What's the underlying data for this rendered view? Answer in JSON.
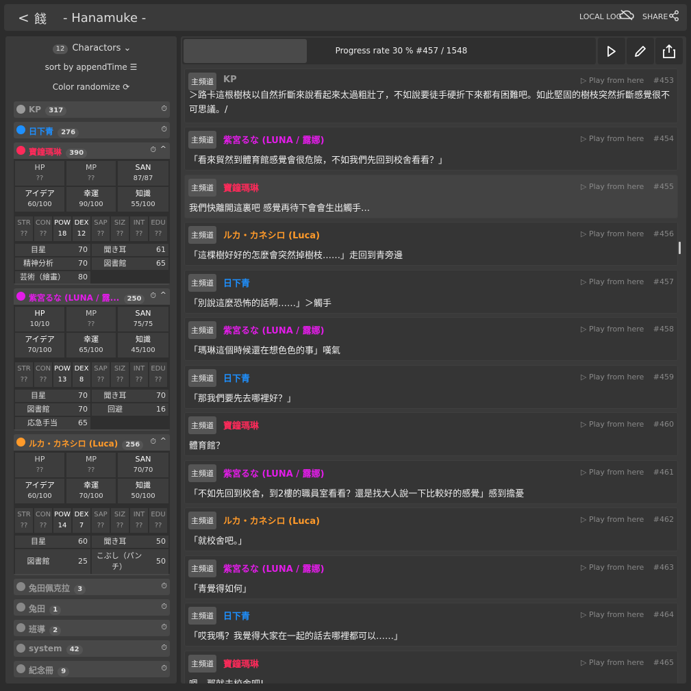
{
  "header": {
    "back_glyph": "<",
    "room_glyph": "餞",
    "title": "- Hanamuke -",
    "local_log": "LOCAL LOG",
    "share": "SHARE"
  },
  "sidebar": {
    "char_count": "12",
    "characters_label": "Charactors",
    "sort_label": "sort by appendTime",
    "color_label": "Color randomize",
    "characters": [
      {
        "name": "KP",
        "count": "317",
        "color": "#9a9a9a"
      },
      {
        "name": "日下青",
        "count": "276",
        "color": "#1e90ff"
      },
      {
        "name": "寶鐘瑪琳",
        "count": "390",
        "color": "#ff2a5a",
        "hp": "??",
        "mp": "??",
        "san": "87/87",
        "idea": "60/100",
        "luck": "90/100",
        "know": "55/100",
        "abilities": [
          [
            "STR",
            "??"
          ],
          [
            "CON",
            "??"
          ],
          [
            "POW",
            "18"
          ],
          [
            "DEX",
            "12"
          ],
          [
            "SAP",
            "??"
          ],
          [
            "SIZ",
            "??"
          ],
          [
            "INT",
            "??"
          ],
          [
            "EDU",
            "??"
          ]
        ],
        "skills": [
          [
            "目星",
            "70"
          ],
          [
            "聞き耳",
            "61"
          ],
          [
            "精神分析",
            "70"
          ],
          [
            "図書館",
            "65"
          ],
          [
            "芸術（繪畫）",
            "80"
          ]
        ]
      },
      {
        "name": "紫宮るな (LUNA / 露...",
        "count": "250",
        "color": "#e21ce8",
        "hp": "10/10",
        "mp": "??",
        "san": "75/75",
        "idea": "70/100",
        "luck": "65/100",
        "know": "45/100",
        "abilities": [
          [
            "STR",
            "??"
          ],
          [
            "CON",
            "??"
          ],
          [
            "POW",
            "13"
          ],
          [
            "DEX",
            "8"
          ],
          [
            "SAP",
            "??"
          ],
          [
            "SIZ",
            "??"
          ],
          [
            "INT",
            "??"
          ],
          [
            "EDU",
            "??"
          ]
        ],
        "skills": [
          [
            "目星",
            "70"
          ],
          [
            "聞き耳",
            "70"
          ],
          [
            "図書館",
            "70"
          ],
          [
            "回避",
            "16"
          ],
          [
            "応急手当",
            "65"
          ]
        ]
      },
      {
        "name": "ルカ・カネシロ (Luca)",
        "count": "256",
        "color": "#ff9a2a",
        "hp": "??",
        "mp": "??",
        "san": "70/70",
        "idea": "60/100",
        "luck": "70/100",
        "know": "50/100",
        "abilities": [
          [
            "STR",
            "??"
          ],
          [
            "CON",
            "??"
          ],
          [
            "POW",
            "14"
          ],
          [
            "DEX",
            "7"
          ],
          [
            "SAP",
            "??"
          ],
          [
            "SIZ",
            "??"
          ],
          [
            "INT",
            "??"
          ],
          [
            "EDU",
            "??"
          ]
        ],
        "skills": [
          [
            "目星",
            "60"
          ],
          [
            "聞き耳",
            "50"
          ],
          [
            "図書館",
            "25"
          ],
          [
            "こぶし（パンチ）",
            "50"
          ]
        ]
      },
      {
        "name": "兔田佩克拉",
        "count": "3",
        "color": "#9a9a9a"
      },
      {
        "name": "兔田",
        "count": "1",
        "color": "#9a9a9a"
      },
      {
        "name": "班導",
        "count": "2",
        "color": "#9a9a9a"
      },
      {
        "name": "system",
        "count": "42",
        "color": "#9a9a9a"
      },
      {
        "name": "紀念冊",
        "count": "9",
        "color": "#9a9a9a"
      }
    ],
    "stat_labels": {
      "hp": "HP",
      "mp": "MP",
      "san": "SAN",
      "idea": "アイデア",
      "luck": "幸運",
      "know": "知識"
    }
  },
  "toolbar": {
    "progress_text": "Progress rate 30 %  #457 / 1548",
    "progress_fraction": 0.3
  },
  "play_label": "Play from here",
  "messages": [
    {
      "channel": "主頻道",
      "who": "KP",
      "color": "#9a9a9a",
      "num": "#453",
      "text": "＞路卡這根樹枝以自然折斷來說看起來太過粗壯了，不如說要徒手硬折下來都有困難吧。如此堅固的樹枝突然折斷感覺很不可思議。/"
    },
    {
      "channel": "主頻道",
      "who": "紫宮るな (LUNA / 露娜)",
      "color": "#e21ce8",
      "num": "#454",
      "text": "「看來貿然到體育館感覺會很危險，不如我們先回到校舍看看？」"
    },
    {
      "channel": "主頻道",
      "who": "寶鐘瑪琳",
      "color": "#ff2a5a",
      "num": "#455",
      "text": "我們快離開這裏吧 感覺再待下會會生出觸手…"
    },
    {
      "channel": "主頻道",
      "who": "ルカ・カネシロ (Luca)",
      "color": "#ff9a2a",
      "num": "#456",
      "text": "「這棵樹好好的怎麼會突然掉樹枝……」走回到青旁邊"
    },
    {
      "channel": "主頻道",
      "who": "日下青",
      "color": "#1e90ff",
      "num": "#457",
      "text": "「別說這麼恐怖的話啊……」＞觸手"
    },
    {
      "channel": "主頻道",
      "who": "紫宮るな (LUNA / 露娜)",
      "color": "#e21ce8",
      "num": "#458",
      "text": "「瑪琳這個時候還在想色色的事」嘆氣"
    },
    {
      "channel": "主頻道",
      "who": "日下青",
      "color": "#1e90ff",
      "num": "#459",
      "text": "「那我們要先去哪裡好？」"
    },
    {
      "channel": "主頻道",
      "who": "寶鐘瑪琳",
      "color": "#ff2a5a",
      "num": "#460",
      "text": "體育館？"
    },
    {
      "channel": "主頻道",
      "who": "紫宮るな (LUNA / 露娜)",
      "color": "#e21ce8",
      "num": "#461",
      "text": "「不如先回到校舍，到2樓的職員室看看？還是找大人說一下比較好的感覺」感到擔憂"
    },
    {
      "channel": "主頻道",
      "who": "ルカ・カネシロ (Luca)",
      "color": "#ff9a2a",
      "num": "#462",
      "text": "「就校舍吧。」"
    },
    {
      "channel": "主頻道",
      "who": "紫宮るな (LUNA / 露娜)",
      "color": "#e21ce8",
      "num": "#463",
      "text": "「青覺得如何」"
    },
    {
      "channel": "主頻道",
      "who": "日下青",
      "color": "#1e90ff",
      "num": "#464",
      "text": "「哎我嗎？我覺得大家在一起的話去哪裡都可以……」"
    },
    {
      "channel": "主頻道",
      "who": "寶鐘瑪琳",
      "color": "#ff2a5a",
      "num": "#465",
      "text": "嗯，那就去校舍吧!"
    }
  ]
}
